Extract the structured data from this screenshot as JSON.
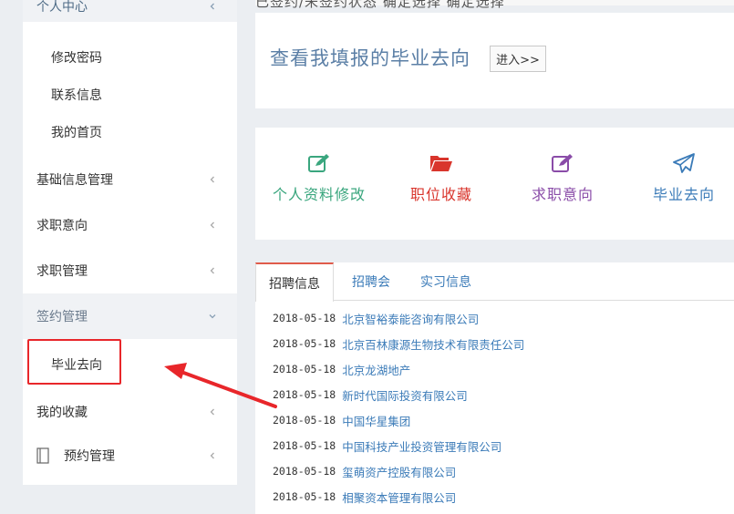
{
  "sidebar": {
    "top_group": "个人中心",
    "sub_items": [
      "修改密码",
      "联系信息",
      "我的首页"
    ],
    "items": [
      {
        "label": "基础信息管理"
      },
      {
        "label": "求职意向"
      },
      {
        "label": "求职管理"
      },
      {
        "label": "签约管理"
      }
    ],
    "signing_sub": "毕业去向",
    "favorites": "我的收藏",
    "appointment": "预约管理"
  },
  "header": {
    "partial_text": "已签约/未签约状态    确定选择    确定选择"
  },
  "view_card": {
    "title": "查看我填报的毕业去向",
    "button": "进入>>"
  },
  "shortcuts": [
    {
      "label": "个人资料修改",
      "icon": "edit-square-icon",
      "color": "#3aa67e"
    },
    {
      "label": "职位收藏",
      "icon": "folder-open-icon",
      "color": "#d9352c"
    },
    {
      "label": "求职意向",
      "icon": "edit-square-icon",
      "color": "#8a4ca8"
    },
    {
      "label": "毕业去向",
      "icon": "paper-plane-icon",
      "color": "#3b7bb8"
    }
  ],
  "tabs": [
    "招聘信息",
    "招聘会",
    "实习信息"
  ],
  "jobs": [
    {
      "date": "2018-05-18",
      "company": "北京智裕泰能咨询有限公司"
    },
    {
      "date": "2018-05-18",
      "company": "北京百林康源生物技术有限责任公司"
    },
    {
      "date": "2018-05-18",
      "company": "北京龙湖地产"
    },
    {
      "date": "2018-05-18",
      "company": "新时代国际投资有限公司"
    },
    {
      "date": "2018-05-18",
      "company": "中国华星集团"
    },
    {
      "date": "2018-05-18",
      "company": "中国科技产业投资管理有限公司"
    },
    {
      "date": "2018-05-18",
      "company": "玺萌资产控股有限公司"
    },
    {
      "date": "2018-05-18",
      "company": "相聚资本管理有限公司"
    }
  ],
  "colors": {
    "highlight": "#e8262a",
    "link": "#3b7bb8",
    "title_blue": "#5b7fa6"
  }
}
